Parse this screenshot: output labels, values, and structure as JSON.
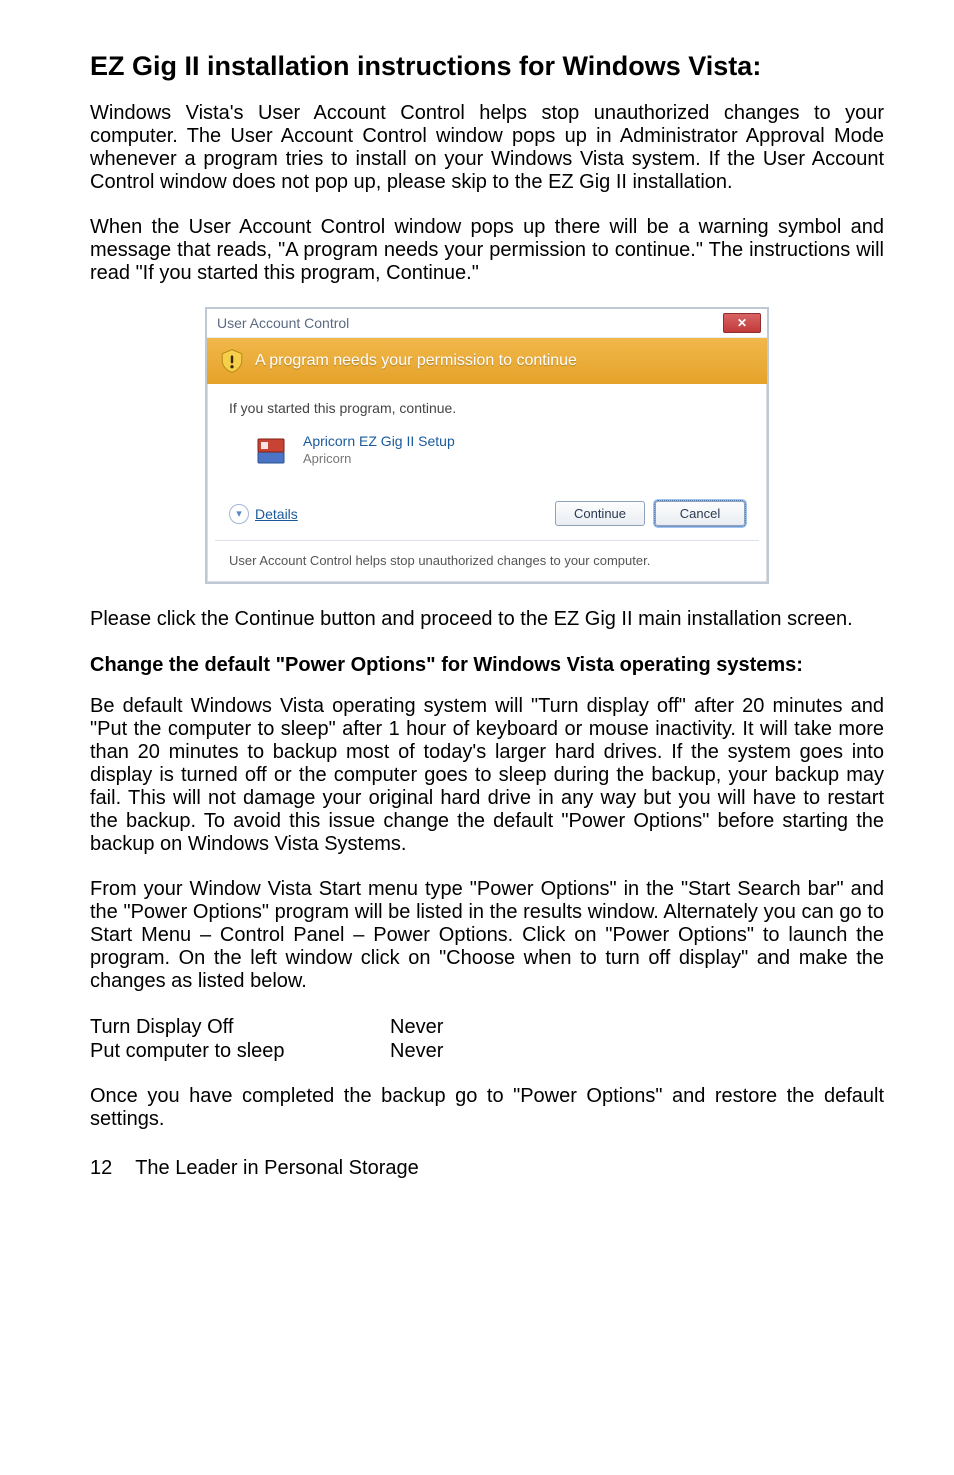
{
  "heading": "EZ Gig II installation instructions for Windows Vista:",
  "para1": "Windows Vista's User Account Control helps stop unauthorized changes to your computer. The User Account Control window pops up in Administrator Approval Mode whenever a program tries to install on your Windows Vista system. If the User Account Control window does not pop up, please skip to the EZ Gig II installation.",
  "para2": "When the User Account Control window pops up there will be a warning symbol and message that reads, \"A program needs your permission to continue.\"   The instructions will read \"If you started this program, Continue.\"",
  "uac": {
    "title": "User Account Control",
    "header": "A program needs your permission to continue",
    "started": "If you started this program, continue.",
    "program_name": "Apricorn EZ Gig II Setup",
    "publisher": "Apricorn",
    "details_label": "Details",
    "continue_label": "Continue",
    "cancel_label": "Cancel",
    "footer": "User Account Control helps stop unauthorized changes to your computer."
  },
  "para3": "Please click the Continue button and proceed to the EZ Gig II main installation screen.",
  "subhead1": "Change the default \"Power Options\" for Windows Vista operating systems:",
  "para4": "Be default Windows Vista operating system will \"Turn display off\" after 20 minutes and \"Put the computer to sleep\" after 1 hour of keyboard or mouse inactivity.  It will take more than 20 minutes to backup most of today's larger hard drives. If the system goes into display is turned off or the computer goes to sleep during the backup, your backup may fail. This will not damage your original hard drive in any way but you will have to restart the backup. To avoid this issue change the default \"Power Options\" before starting the backup on Windows Vista Systems.",
  "para5": "From your Window Vista Start menu type \"Power Options\" in the \"Start Search bar\" and the \"Power Options\" program will be listed in the results window. Alternately you can go to Start Menu – Control Panel – Power Options. Click on \"Power Options\" to launch the program. On the left window click on \"Choose when to turn off display\" and make the changes as listed below.",
  "settings": {
    "row1_key": "Turn Display Off",
    "row1_val": "Never",
    "row2_key": "Put computer to sleep",
    "row2_val": "Never"
  },
  "para6": "Once you have completed the backup go to \"Power Options\" and restore the default settings.",
  "footer_page": "12",
  "footer_text": "The Leader in Personal Storage"
}
